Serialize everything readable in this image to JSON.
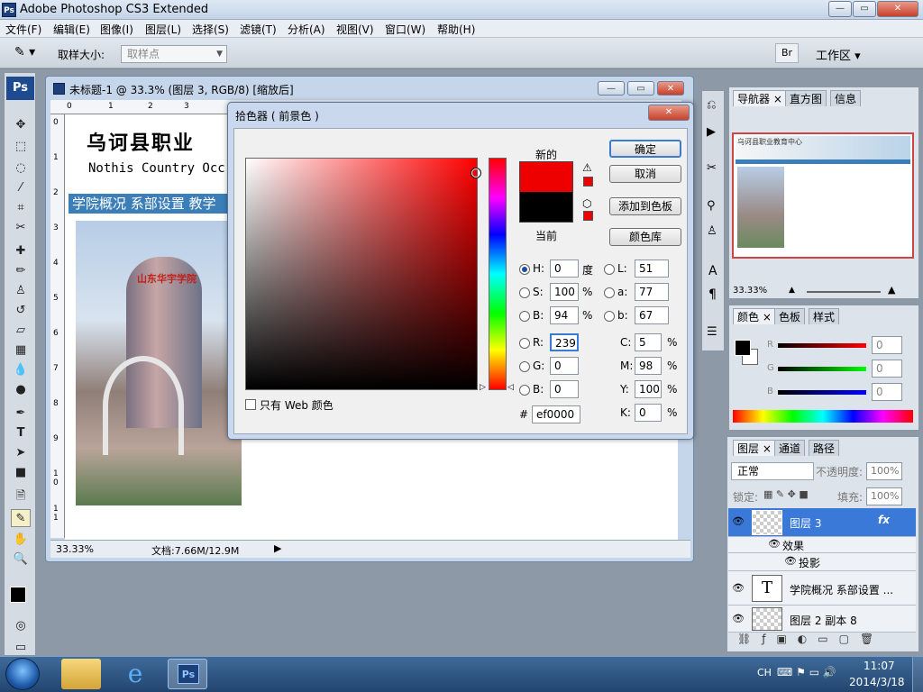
{
  "app": {
    "title": "Adobe Photoshop CS3 Extended",
    "logo": "Ps"
  },
  "menu": [
    "文件(F)",
    "编辑(E)",
    "图像(I)",
    "图层(L)",
    "选择(S)",
    "滤镜(T)",
    "分析(A)",
    "视图(V)",
    "窗口(W)",
    "帮助(H)"
  ],
  "options": {
    "sample_label": "取样大小:",
    "sample_value": "取样点",
    "workspace": "工作区 ▾"
  },
  "toolbox": {
    "ps": "Ps"
  },
  "document": {
    "title": "未标题-1 @ 33.3% (图层 3, RGB/8) [缩放后]",
    "heading": "乌诃县职业",
    "subheading": "Nothis Country Occ",
    "nav": "学院概况 系部设置 教学",
    "zoom": "33.33%",
    "doc_size": "文档:7.66M/12.9M",
    "ruler_h": [
      "0",
      "1",
      "2",
      "3"
    ],
    "ruler_v": [
      "0",
      "1",
      "2",
      "3",
      "4",
      "5",
      "6",
      "7",
      "8",
      "9",
      "1\n0",
      "1\n1"
    ]
  },
  "color_picker": {
    "title": "拾色器 ( 前景色 )",
    "new_label": "新的",
    "current_label": "当前",
    "new_color": "#ef0000",
    "current_color": "#000000",
    "buttons": {
      "ok": "确定",
      "cancel": "取消",
      "add_swatch": "添加到色板",
      "libraries": "颜色库"
    },
    "web_only": "只有 Web 颜色",
    "hsb": {
      "h": "0",
      "h_unit": "度",
      "s": "100",
      "s_unit": "%",
      "b": "94",
      "b_unit": "%"
    },
    "rgb": {
      "r": "239",
      "g": "0",
      "b": "0"
    },
    "lab": {
      "l": "51",
      "a": "77",
      "b": "67"
    },
    "cmyk": {
      "c": "5",
      "m": "98",
      "y": "100",
      "k": "0",
      "unit": "%"
    },
    "labels": {
      "h": "H:",
      "s": "S:",
      "bb": "B:",
      "r": "R:",
      "g": "G:",
      "b": "B:",
      "l": "L:",
      "a": "a:",
      "lb": "b:",
      "c": "C:",
      "m": "M:",
      "y": "Y:",
      "k": "K:",
      "hex": "#"
    },
    "hex": "ef0000"
  },
  "navigator": {
    "tabs": [
      "导航器",
      "直方图",
      "信息"
    ],
    "zoom": "33.33%",
    "preview_title": "乌诃县职业教育中心"
  },
  "color_panel": {
    "tabs": [
      "颜色",
      "色板",
      "样式"
    ],
    "r_label": "R",
    "g_label": "G",
    "b_label": "B",
    "r": "0",
    "g": "0",
    "b": "0"
  },
  "layers": {
    "tabs": [
      "图层",
      "通道",
      "路径"
    ],
    "blend": "正常",
    "opacity_label": "不透明度:",
    "opacity": "100%",
    "lock_label": "锁定:",
    "fill_label": "填充:",
    "fill": "100%",
    "rows": [
      {
        "name": "图层 3",
        "fx": "fx"
      },
      {
        "name": "效果"
      },
      {
        "name": "投影"
      },
      {
        "name": "学院概况 系部设置 ...",
        "thumb": "T"
      },
      {
        "name": "图层 2 副本 8"
      }
    ]
  },
  "taskbar": {
    "lang": "CH",
    "time": "11:07",
    "date": "2014/3/18"
  }
}
